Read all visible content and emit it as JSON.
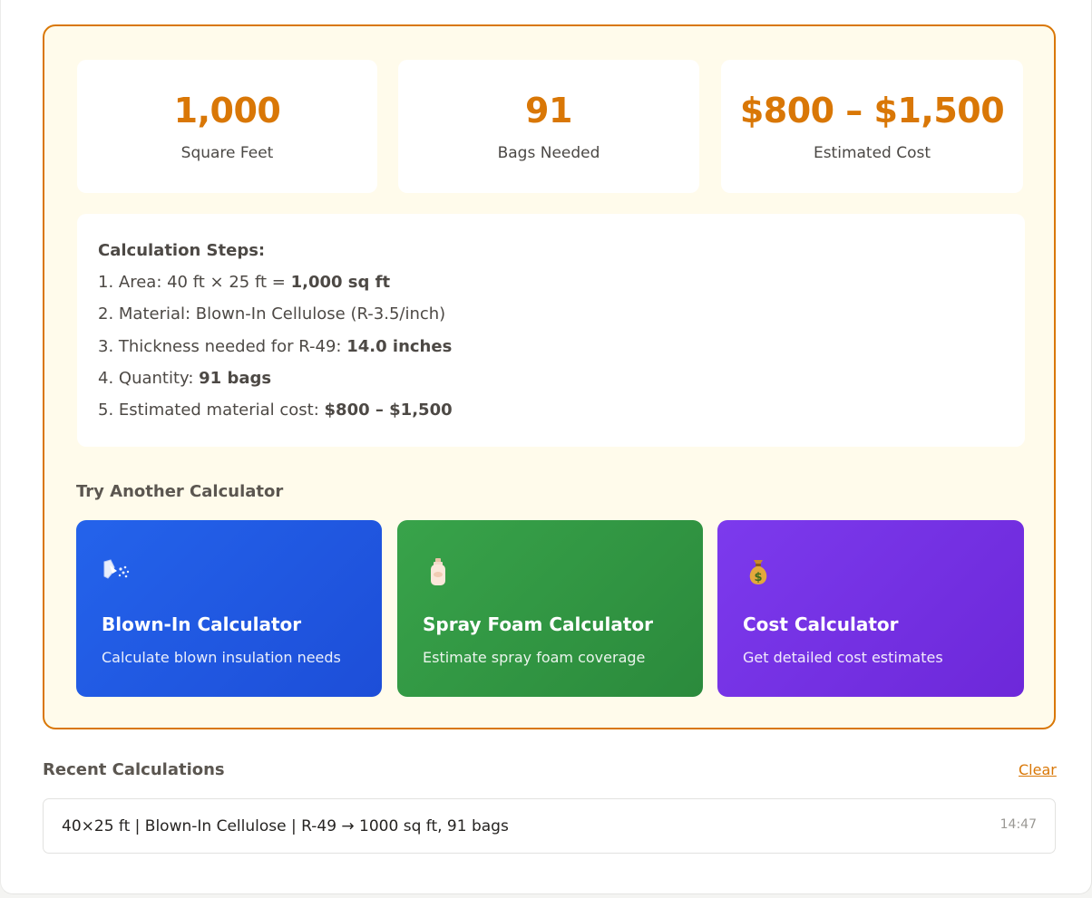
{
  "stats": [
    {
      "value": "1,000",
      "label": "Square Feet"
    },
    {
      "value": "91",
      "label": "Bags Needed"
    },
    {
      "value": "$800 – $1,500",
      "label": "Estimated Cost"
    }
  ],
  "steps": {
    "title": "Calculation Steps:",
    "items": [
      {
        "text": "1. Area: 40 ft × 25 ft = ",
        "bold": "1,000 sq ft"
      },
      {
        "text": "2. Material: Blown-In Cellulose (R-3.5/inch)",
        "bold": ""
      },
      {
        "text": "3. Thickness needed for R-49: ",
        "bold": "14.0 inches"
      },
      {
        "text": "4. Quantity: ",
        "bold": "91 bags"
      },
      {
        "text": "5. Estimated material cost: ",
        "bold": "$800 – $1,500"
      }
    ]
  },
  "try_another": {
    "title": "Try Another Calculator",
    "cards": [
      {
        "icon": "blower-icon",
        "title": "Blown-In Calculator",
        "description": "Calculate blown insulation needs",
        "color": "#2463eb"
      },
      {
        "icon": "bottle-icon",
        "title": "Spray Foam Calculator",
        "description": "Estimate spray foam coverage",
        "color": "#38a34a"
      },
      {
        "icon": "money-bag-icon",
        "title": "Cost Calculator",
        "description": "Get detailed cost estimates",
        "color": "#7c3aed"
      }
    ]
  },
  "recent": {
    "title": "Recent Calculations",
    "clear_label": "Clear",
    "items": [
      {
        "text": "40×25 ft | Blown-In Cellulose | R-49 → 1000 sq ft, 91 bags",
        "time": "14:47"
      }
    ]
  },
  "colors": {
    "accent": "#d97706",
    "panel_bg": "#fffbeb",
    "blue": "#2463eb",
    "green": "#38a34a",
    "purple": "#7c3aed"
  }
}
